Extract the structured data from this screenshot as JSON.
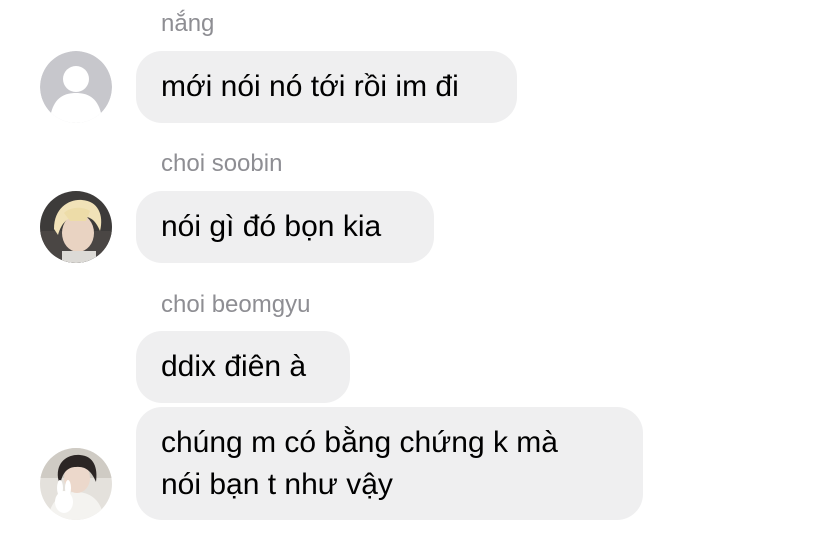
{
  "messages": [
    {
      "sender": "nắng",
      "avatar": "default-avatar-icon",
      "bubbles": [
        "mới nói nó tới rồi im đi"
      ]
    },
    {
      "sender": "choi soobin",
      "avatar": "profile-photo-blond-person",
      "bubbles": [
        "nói gì đó bọn kia"
      ]
    },
    {
      "sender": "choi beomgyu",
      "avatar": "profile-photo-person-with-plush",
      "bubbles": [
        "ddix điên à",
        "chúng m có bằng chứng k mà",
        "nói bạn t như vậy"
      ]
    }
  ],
  "colors": {
    "bubble_bg": "#efeff0",
    "sender_text": "#8e8e93",
    "message_text": "#000000",
    "default_avatar_bg": "#c7c7cc"
  }
}
